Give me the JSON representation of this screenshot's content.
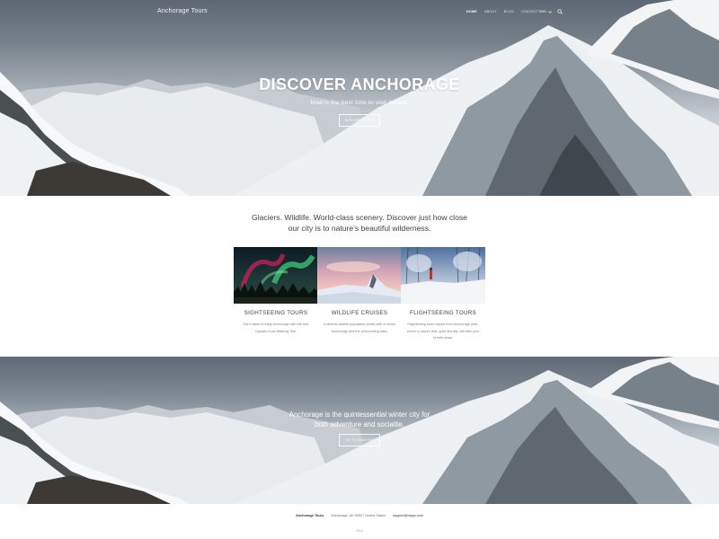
{
  "navbar": {
    "brand": "Anchorage Tours",
    "links": [
      "HOME",
      "ABOUT",
      "BLOG",
      "CONTACT"
    ],
    "language": "ENG"
  },
  "hero": {
    "title": "DISCOVER ANCHORAGE",
    "subtitle": "Now is the best time to visit Alaska.",
    "button_label": "EXPLORE TOURS"
  },
  "intro": {
    "text": "Glaciers. Wildlife. World-class scenery. Discover just how close our city is to nature's beautiful wilderness."
  },
  "tours": [
    {
      "title": "SIGHTSEEING TOURS",
      "text": "Get a taste of early Anchorage with the free Captain Cook Walking Tour.",
      "image": "northern-lights-forest"
    },
    {
      "title": "WILDLIFE CRUISES",
      "text": "A diverse wildlife population exists with in urban Anchorage and the surrounding area.",
      "image": "snowy-peak-sunset"
    },
    {
      "title": "FLIGHTSEEING TOURS",
      "text": "Flightseeing tours depart from Anchorage year-round to places that, quite literally, will take your breath away.",
      "image": "hiker-in-snowy-forest"
    }
  ],
  "banner": {
    "text": "Anchorage is the quintessential winter city for both adventure and socialite.",
    "button_label": "GO TO BOOKING"
  },
  "footer": {
    "brand": "Anchorage Tours",
    "address": "Anchorage, AK 99507 United States",
    "email": "support@mysp.com",
    "copyright": "2016"
  },
  "colors": {
    "page_background": "#ffffff",
    "heading_text": "#3a3f43",
    "body_text": "#7c8287",
    "hero_text": "#ffffff"
  }
}
